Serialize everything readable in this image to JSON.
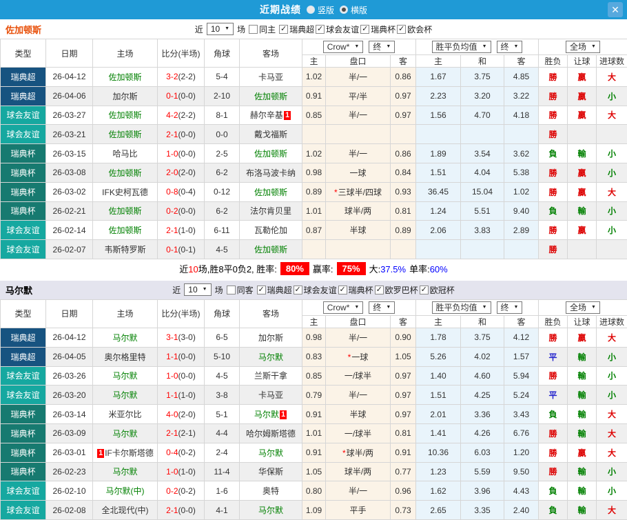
{
  "icons": {
    "close": "✕",
    "caret": "▼",
    "check": "✓",
    "star": "*"
  },
  "colors": {
    "titlebar_bg": "#1f9ad6",
    "close_btn_bg": "#57a9de",
    "section2_header_bg": "#e4e4ee",
    "section1_team": "#e8500a",
    "section2_team": "#000000",
    "leagues": {
      "瑞典超": "#175380",
      "球会友谊": "#16a8a0",
      "瑞典杯": "#177a70"
    },
    "results": {
      "勝": "#dd0000",
      "負": "#008000",
      "平": "#2020cc",
      "贏": "#dd0000",
      "輸": "#008000",
      "大": "#dd0000",
      "小": "#008000"
    }
  },
  "titlebar": {
    "title": "近期战绩",
    "radio_options": [
      {
        "label": "竖版",
        "selected": false
      },
      {
        "label": "横版",
        "selected": true
      }
    ]
  },
  "table_header": {
    "type": "类型",
    "date": "日期",
    "home": "主场",
    "score": "比分(半场)",
    "corner": "角球",
    "away": "客场",
    "dd_company": "Crow*",
    "dd_final1": "终",
    "dd_avg": "胜平负均值",
    "dd_final2": "终",
    "dd_full": "全场",
    "odds_home": "主",
    "handicap": "盘口",
    "odds_away": "客",
    "avg_home": "主",
    "avg_draw": "和",
    "avg_away": "客",
    "result": "胜负",
    "let_goal": "让球",
    "goals": "进球数"
  },
  "sections": [
    {
      "team": "佐加顿斯",
      "filter": {
        "prefix": "近",
        "count": "10",
        "suffix": "场",
        "same_label": "同主",
        "same_checked": false,
        "leagues": [
          {
            "label": "瑞典超",
            "checked": true
          },
          {
            "label": "球会友谊",
            "checked": true
          },
          {
            "label": "瑞典杯",
            "checked": true
          },
          {
            "label": "欧会杯",
            "checked": true
          }
        ]
      },
      "rows": [
        {
          "type": "瑞典超",
          "date": "26-04-12",
          "home": "佐加顿斯",
          "home_green": true,
          "home_badge_before": "",
          "score": "3-2",
          "half": "(2-2)",
          "corners": "5-4",
          "away": "卡马亚",
          "away_green": false,
          "away_badge_after": "",
          "odds_home": "1.02",
          "handicap": "半/一",
          "handicap_star": false,
          "odds_away": "0.86",
          "avg_home": "1.67",
          "avg_draw": "3.75",
          "avg_away": "4.85",
          "result": "勝",
          "handicap_result": "贏",
          "goals_result": "大"
        },
        {
          "type": "瑞典超",
          "date": "26-04-06",
          "home": "加尔斯",
          "home_green": false,
          "home_badge_before": "",
          "score": "0-1",
          "half": "(0-0)",
          "corners": "2-10",
          "away": "佐加顿斯",
          "away_green": true,
          "away_badge_after": "",
          "odds_home": "0.91",
          "handicap": "平/半",
          "handicap_star": false,
          "odds_away": "0.97",
          "avg_home": "2.23",
          "avg_draw": "3.20",
          "avg_away": "3.22",
          "result": "勝",
          "handicap_result": "贏",
          "goals_result": "小"
        },
        {
          "type": "球会友谊",
          "date": "26-03-27",
          "home": "佐加顿斯",
          "home_green": true,
          "home_badge_before": "",
          "score": "4-2",
          "half": "(2-2)",
          "corners": "8-1",
          "away": "赫尔辛基",
          "away_green": false,
          "away_badge_after": "1",
          "odds_home": "0.85",
          "handicap": "半/一",
          "handicap_star": false,
          "odds_away": "0.97",
          "avg_home": "1.56",
          "avg_draw": "4.70",
          "avg_away": "4.18",
          "result": "勝",
          "handicap_result": "贏",
          "goals_result": "大"
        },
        {
          "type": "球会友谊",
          "date": "26-03-21",
          "home": "佐加顿斯",
          "home_green": true,
          "home_badge_before": "",
          "score": "2-1",
          "half": "(0-0)",
          "corners": "0-0",
          "away": "戴戈福斯",
          "away_green": false,
          "away_badge_after": "",
          "odds_home": "",
          "handicap": "",
          "handicap_star": false,
          "odds_away": "",
          "avg_home": "",
          "avg_draw": "",
          "avg_away": "",
          "result": "勝",
          "handicap_result": "",
          "goals_result": ""
        },
        {
          "type": "瑞典杯",
          "date": "26-03-15",
          "home": "哈马比",
          "home_green": false,
          "home_badge_before": "",
          "score": "1-0",
          "half": "(0-0)",
          "corners": "2-5",
          "away": "佐加顿斯",
          "away_green": true,
          "away_badge_after": "",
          "odds_home": "1.02",
          "handicap": "半/一",
          "handicap_star": false,
          "odds_away": "0.86",
          "avg_home": "1.89",
          "avg_draw": "3.54",
          "avg_away": "3.62",
          "result": "負",
          "handicap_result": "輸",
          "goals_result": "小"
        },
        {
          "type": "瑞典杯",
          "date": "26-03-08",
          "home": "佐加顿斯",
          "home_green": true,
          "home_badge_before": "",
          "score": "2-0",
          "half": "(2-0)",
          "corners": "6-2",
          "away": "布洛马波卡纳",
          "away_green": false,
          "away_badge_after": "",
          "odds_home": "0.98",
          "handicap": "一球",
          "handicap_star": false,
          "odds_away": "0.84",
          "avg_home": "1.51",
          "avg_draw": "4.04",
          "avg_away": "5.38",
          "result": "勝",
          "handicap_result": "贏",
          "goals_result": "小"
        },
        {
          "type": "瑞典杯",
          "date": "26-03-02",
          "home": "IFK史柯瓦德",
          "home_green": false,
          "home_badge_before": "",
          "score": "0-8",
          "half": "(0-4)",
          "corners": "0-12",
          "away": "佐加顿斯",
          "away_green": true,
          "away_badge_after": "",
          "odds_home": "0.89",
          "handicap": "三球半/四球",
          "handicap_star": true,
          "odds_away": "0.93",
          "avg_home": "36.45",
          "avg_draw": "15.04",
          "avg_away": "1.02",
          "result": "勝",
          "handicap_result": "贏",
          "goals_result": "大"
        },
        {
          "type": "瑞典杯",
          "date": "26-02-21",
          "home": "佐加顿斯",
          "home_green": true,
          "home_badge_before": "",
          "score": "0-2",
          "half": "(0-0)",
          "corners": "6-2",
          "away": "法尔肯贝里",
          "away_green": false,
          "away_badge_after": "",
          "odds_home": "1.01",
          "handicap": "球半/两",
          "handicap_star": false,
          "odds_away": "0.81",
          "avg_home": "1.24",
          "avg_draw": "5.51",
          "avg_away": "9.40",
          "result": "負",
          "handicap_result": "輸",
          "goals_result": "小"
        },
        {
          "type": "球会友谊",
          "date": "26-02-14",
          "home": "佐加顿斯",
          "home_green": true,
          "home_badge_before": "",
          "score": "2-1",
          "half": "(1-0)",
          "corners": "6-11",
          "away": "瓦勒伦加",
          "away_green": false,
          "away_badge_after": "",
          "odds_home": "0.87",
          "handicap": "半球",
          "handicap_star": false,
          "odds_away": "0.89",
          "avg_home": "2.06",
          "avg_draw": "3.83",
          "avg_away": "2.89",
          "result": "勝",
          "handicap_result": "贏",
          "goals_result": "小"
        },
        {
          "type": "球会友谊",
          "date": "26-02-07",
          "home": "韦斯特罗斯",
          "home_green": false,
          "home_badge_before": "",
          "score": "0-1",
          "half": "(0-1)",
          "corners": "4-5",
          "away": "佐加顿斯",
          "away_green": true,
          "away_badge_after": "",
          "odds_home": "",
          "handicap": "",
          "handicap_star": false,
          "odds_away": "",
          "avg_home": "",
          "avg_draw": "",
          "avg_away": "",
          "result": "勝",
          "handicap_result": "",
          "goals_result": ""
        }
      ],
      "summary": {
        "t1": "近",
        "count": "10",
        "t2": "场,胜8平0负2, 胜率:",
        "rate1": "80%",
        "t3": "赢率:",
        "rate2": "75%",
        "t4": "大:",
        "big": "37.5%",
        "t5": "单率:",
        "single": "60%"
      }
    },
    {
      "team": "马尔默",
      "filter": {
        "prefix": "近",
        "count": "10",
        "suffix": "场",
        "same_label": "同客",
        "same_checked": false,
        "leagues": [
          {
            "label": "瑞典超",
            "checked": true
          },
          {
            "label": "球会友谊",
            "checked": true
          },
          {
            "label": "瑞典杯",
            "checked": true
          },
          {
            "label": "欧罗巴杯",
            "checked": true
          },
          {
            "label": "欧冠杯",
            "checked": true
          }
        ]
      },
      "rows": [
        {
          "type": "瑞典超",
          "date": "26-04-12",
          "home": "马尔默",
          "home_green": true,
          "home_badge_before": "",
          "score": "3-1",
          "half": "(3-0)",
          "corners": "6-5",
          "away": "加尔斯",
          "away_green": false,
          "away_badge_after": "",
          "odds_home": "0.98",
          "handicap": "半/一",
          "handicap_star": false,
          "odds_away": "0.90",
          "avg_home": "1.78",
          "avg_draw": "3.75",
          "avg_away": "4.12",
          "result": "勝",
          "handicap_result": "贏",
          "goals_result": "大"
        },
        {
          "type": "瑞典超",
          "date": "26-04-05",
          "home": "奥尔格里特",
          "home_green": false,
          "home_badge_before": "",
          "score": "1-1",
          "half": "(0-0)",
          "corners": "5-10",
          "away": "马尔默",
          "away_green": true,
          "away_badge_after": "",
          "odds_home": "0.83",
          "handicap": "一球",
          "handicap_star": true,
          "odds_away": "1.05",
          "avg_home": "5.26",
          "avg_draw": "4.02",
          "avg_away": "1.57",
          "result": "平",
          "handicap_result": "輸",
          "goals_result": "小"
        },
        {
          "type": "球会友谊",
          "date": "26-03-26",
          "home": "马尔默",
          "home_green": true,
          "home_badge_before": "",
          "score": "1-0",
          "half": "(0-0)",
          "corners": "4-5",
          "away": "兰斯干拿",
          "away_green": false,
          "away_badge_after": "",
          "odds_home": "0.85",
          "handicap": "一/球半",
          "handicap_star": false,
          "odds_away": "0.97",
          "avg_home": "1.40",
          "avg_draw": "4.60",
          "avg_away": "5.94",
          "result": "勝",
          "handicap_result": "輸",
          "goals_result": "小"
        },
        {
          "type": "球会友谊",
          "date": "26-03-20",
          "home": "马尔默",
          "home_green": true,
          "home_badge_before": "",
          "score": "1-1",
          "half": "(1-0)",
          "corners": "3-8",
          "away": "卡马亚",
          "away_green": false,
          "away_badge_after": "",
          "odds_home": "0.79",
          "handicap": "半/一",
          "handicap_star": false,
          "odds_away": "0.97",
          "avg_home": "1.51",
          "avg_draw": "4.25",
          "avg_away": "5.24",
          "result": "平",
          "handicap_result": "輸",
          "goals_result": "小"
        },
        {
          "type": "瑞典杯",
          "date": "26-03-14",
          "home": "米亚尔比",
          "home_green": false,
          "home_badge_before": "",
          "score": "4-0",
          "half": "(2-0)",
          "corners": "5-1",
          "away": "马尔默",
          "away_green": true,
          "away_badge_after": "1",
          "odds_home": "0.91",
          "handicap": "半球",
          "handicap_star": false,
          "odds_away": "0.97",
          "avg_home": "2.01",
          "avg_draw": "3.36",
          "avg_away": "3.43",
          "result": "負",
          "handicap_result": "輸",
          "goals_result": "大"
        },
        {
          "type": "瑞典杯",
          "date": "26-03-09",
          "home": "马尔默",
          "home_green": true,
          "home_badge_before": "",
          "score": "2-1",
          "half": "(2-1)",
          "corners": "4-4",
          "away": "哈尔姆斯塔德",
          "away_green": false,
          "away_badge_after": "",
          "odds_home": "1.01",
          "handicap": "一/球半",
          "handicap_star": false,
          "odds_away": "0.81",
          "avg_home": "1.41",
          "avg_draw": "4.26",
          "avg_away": "6.76",
          "result": "勝",
          "handicap_result": "輸",
          "goals_result": "大"
        },
        {
          "type": "瑞典杯",
          "date": "26-03-01",
          "home": "IF卡尔斯塔德",
          "home_green": false,
          "home_badge_before": "1",
          "score": "0-4",
          "half": "(0-2)",
          "corners": "2-4",
          "away": "马尔默",
          "away_green": true,
          "away_badge_after": "",
          "odds_home": "0.91",
          "handicap": "球半/两",
          "handicap_star": true,
          "odds_away": "0.91",
          "avg_home": "10.36",
          "avg_draw": "6.03",
          "avg_away": "1.20",
          "result": "勝",
          "handicap_result": "贏",
          "goals_result": "大"
        },
        {
          "type": "瑞典杯",
          "date": "26-02-23",
          "home": "马尔默",
          "home_green": true,
          "home_badge_before": "",
          "score": "1-0",
          "half": "(1-0)",
          "corners": "11-4",
          "away": "华保斯",
          "away_green": false,
          "away_badge_after": "",
          "odds_home": "1.05",
          "handicap": "球半/两",
          "handicap_star": false,
          "odds_away": "0.77",
          "avg_home": "1.23",
          "avg_draw": "5.59",
          "avg_away": "9.50",
          "result": "勝",
          "handicap_result": "輸",
          "goals_result": "小"
        },
        {
          "type": "球会友谊",
          "date": "26-02-10",
          "home": "马尔默(中)",
          "home_green": true,
          "home_badge_before": "",
          "score": "0-2",
          "half": "(0-2)",
          "corners": "1-6",
          "away": "奥特",
          "away_green": false,
          "away_badge_after": "",
          "odds_home": "0.80",
          "handicap": "半/一",
          "handicap_star": false,
          "odds_away": "0.96",
          "avg_home": "1.62",
          "avg_draw": "3.96",
          "avg_away": "4.43",
          "result": "負",
          "handicap_result": "輸",
          "goals_result": "小"
        },
        {
          "type": "球会友谊",
          "date": "26-02-08",
          "home": "全北现代(中)",
          "home_green": false,
          "home_badge_before": "",
          "score": "2-1",
          "half": "(0-0)",
          "corners": "4-1",
          "away": "马尔默",
          "away_green": true,
          "away_badge_after": "",
          "odds_home": "1.09",
          "handicap": "平手",
          "handicap_star": false,
          "odds_away": "0.73",
          "avg_home": "2.65",
          "avg_draw": "3.35",
          "avg_away": "2.40",
          "result": "負",
          "handicap_result": "輸",
          "goals_result": "大"
        }
      ]
    }
  ]
}
